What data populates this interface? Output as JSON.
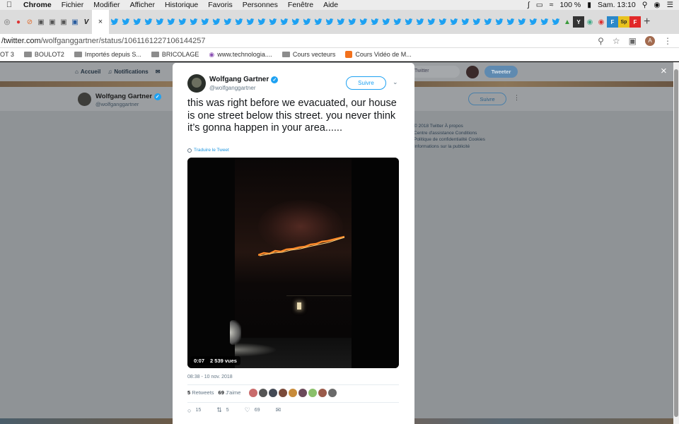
{
  "menubar": {
    "apple": "",
    "items": [
      "Chrome",
      "Fichier",
      "Modifier",
      "Afficher",
      "Historique",
      "Favoris",
      "Personnes",
      "Fenêtre",
      "Aide"
    ],
    "battery": "100 %",
    "clock": "Sam. 13:10"
  },
  "tabs": {
    "active_close": "×",
    "new_tab": "+"
  },
  "address": {
    "url_host": "/twitter.com",
    "url_path": "/wolfganggartner/status/1061161227106144257"
  },
  "bookmarks": [
    {
      "label": "OT 3",
      "type": "text"
    },
    {
      "label": "BOULOT2",
      "type": "folder"
    },
    {
      "label": "Importés depuis S...",
      "type": "folder"
    },
    {
      "label": "BRICOLAGE",
      "type": "folder"
    },
    {
      "label": "www.technologia....",
      "type": "site"
    },
    {
      "label": "Cours vecteurs",
      "type": "folder"
    },
    {
      "label": "Cours Vidéo de M...",
      "type": "site"
    }
  ],
  "twitter_nav": {
    "home": "Accueil",
    "notifications": "Notifications",
    "search_placeholder": "Twitter",
    "tweet_button": "Tweeter"
  },
  "profile_bar": {
    "name": "Wolfgang Gartner",
    "handle": "@wolfganggartner",
    "follow": "Suivre",
    "more": "⋮"
  },
  "footer_links": [
    "© 2018 Twitter   À propos",
    "Centre d'assistance   Conditions",
    "Politique de confidentialité   Cookies",
    "Informations sur la publicité"
  ],
  "tweet": {
    "name": "Wolfgang Gartner",
    "handle": "@wolfganggartner",
    "follow": "Suivre",
    "text": "this was right before we evacuated, our house is one street below this street. you never think it’s gonna happen in your area......",
    "translate": "Traduire le Tweet",
    "video_duration": "0:07",
    "video_views": "2 539 vues",
    "timestamp": "08:38 - 10 nov. 2018",
    "retweets_count": "5",
    "retweets_label": "Retweets",
    "likes_count": "69",
    "likes_label": "J'aime",
    "reply_count": "15",
    "retweet_count": "5",
    "like_count": "69"
  },
  "overlay": {
    "close": "×"
  }
}
